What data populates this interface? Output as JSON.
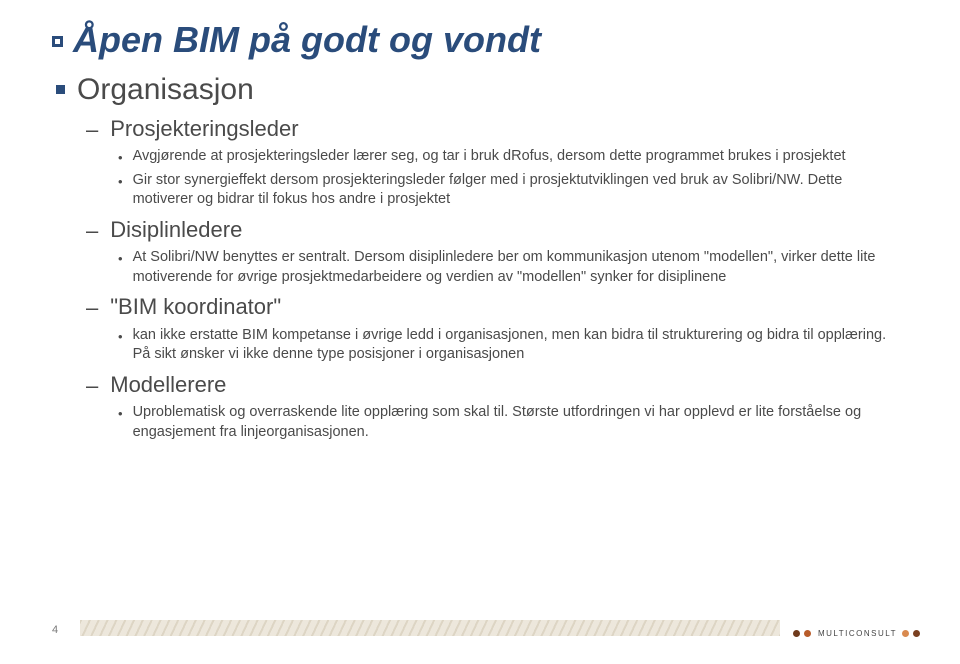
{
  "title": "Åpen BIM på godt og vondt",
  "l1": "Organisasjon",
  "sections": [
    {
      "heading": "Prosjekteringsleder",
      "bullets": [
        "Avgjørende at prosjekteringsleder lærer seg, og tar i bruk dRofus, dersom dette programmet brukes i prosjektet",
        "Gir stor synergieffekt dersom prosjekteringsleder følger med i prosjektutviklingen ved bruk av Solibri/NW. Dette motiverer og bidrar til fokus hos andre i prosjektet"
      ]
    },
    {
      "heading": "Disiplinledere",
      "bullets": [
        "At Solibri/NW benyttes er sentralt. Dersom disiplinledere ber om kommunikasjon utenom \"modellen\", virker dette lite motiverende for øvrige prosjektmedarbeidere og verdien av \"modellen\" synker for disiplinene"
      ]
    },
    {
      "heading": "\"BIM koordinator\"",
      "bullets": [
        "kan ikke erstatte BIM kompetanse i øvrige ledd i organisasjonen, men kan bidra til strukturering og bidra til opplæring. På sikt ønsker vi ikke denne type posisjoner i organisasjonen"
      ]
    },
    {
      "heading": "Modellerere",
      "bullets": [
        "Uproblematisk og overraskende lite opplæring som skal til. Største utfordringen vi har opplevd er lite forståelse og engasjement fra linjeorganisasjonen."
      ]
    }
  ],
  "pageNumber": "4",
  "logoText": "MULTICONSULT"
}
